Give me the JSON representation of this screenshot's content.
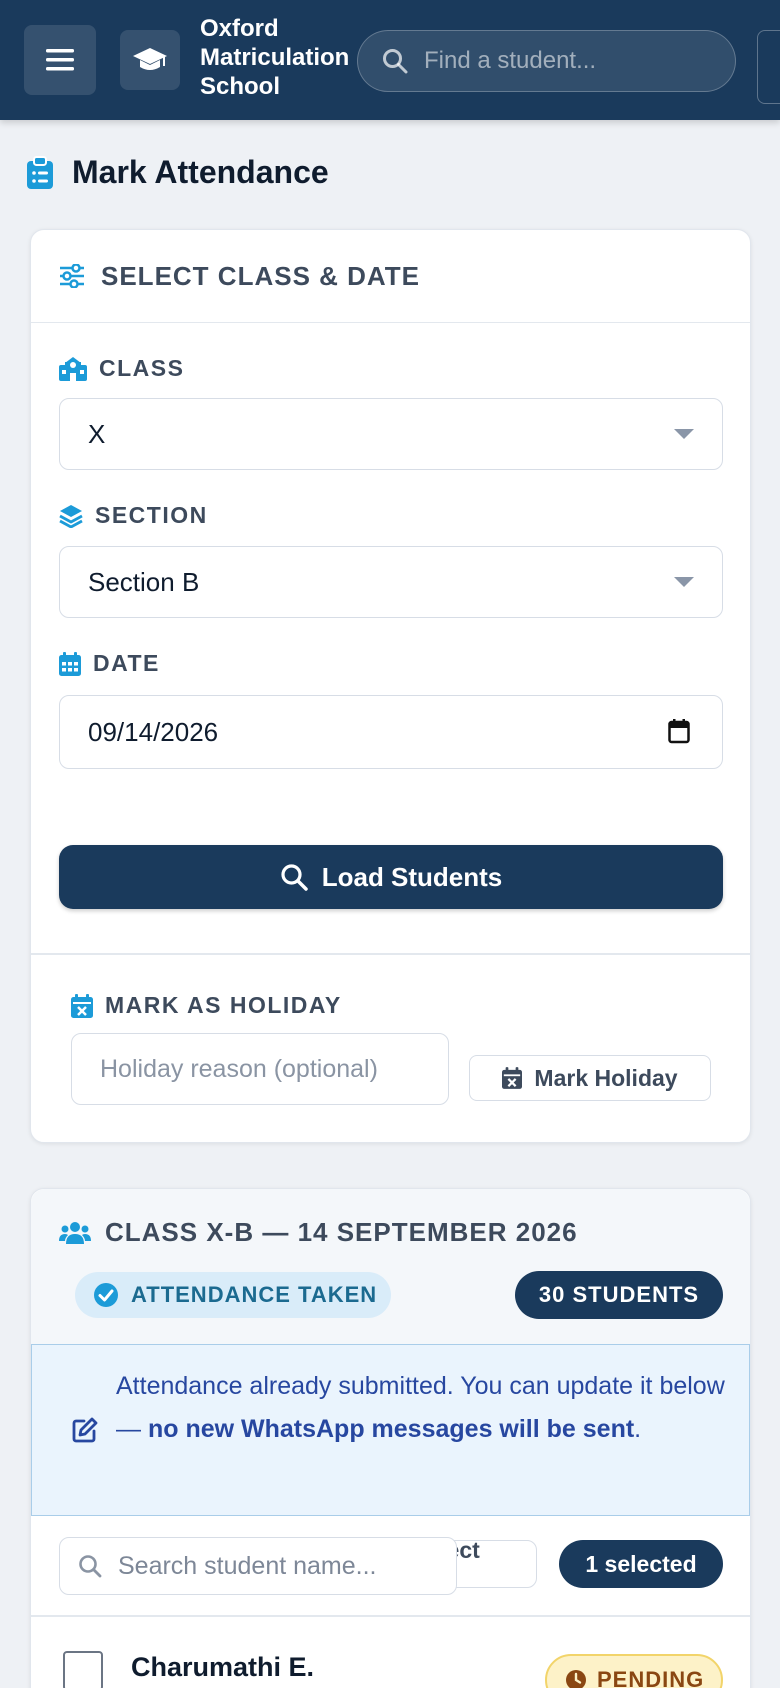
{
  "header": {
    "brand_line1": "Oxford",
    "brand_line2": "Matriculation",
    "brand_line3": "School",
    "search_placeholder": "Find a student..."
  },
  "page": {
    "title": "Mark Attendance"
  },
  "select_card": {
    "title": "SELECT CLASS & DATE",
    "class_label": "CLASS",
    "class_value": "X",
    "section_label": "SECTION",
    "section_value": "Section B",
    "date_label": "DATE",
    "date_value": "09/14/2026",
    "load_button": "Load Students",
    "holiday_label": "MARK AS HOLIDAY",
    "holiday_placeholder": "Holiday reason (optional)",
    "holiday_button": "Mark Holiday"
  },
  "attendance_card": {
    "title": "CLASS X-B — 14 SEPTEMBER 2026",
    "status_badge": "ATTENDANCE TAKEN",
    "count_badge": "30 STUDENTS",
    "alert_text": "Attendance already submitted. You can update it below — ",
    "alert_bold": "no new WhatsApp messages will be sent",
    "alert_end": ".",
    "search_placeholder": "Search student name...",
    "select_all_button": "Select All",
    "selected_badge": "1 selected",
    "students": [
      {
        "name": "Charumathi E.",
        "status": "PENDING"
      }
    ]
  },
  "colors": {
    "primary": "#1a3a5c",
    "accent_icon": "#1c9bd8",
    "pending_bg": "#fdf2c8"
  }
}
